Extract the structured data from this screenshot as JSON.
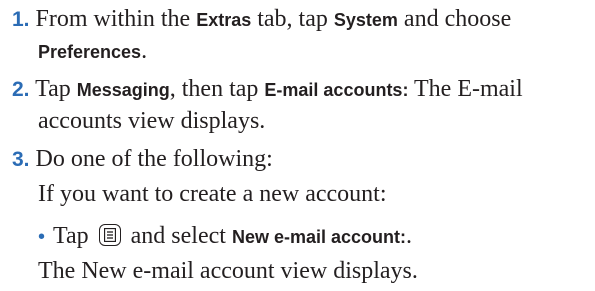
{
  "steps": [
    {
      "num": "1.",
      "t1": "From within the ",
      "u1": "Extras",
      "t2": " tab, tap ",
      "u2": "System",
      "t3": " and choose",
      "u3": "Preferences",
      "t4": "."
    },
    {
      "num": "2.",
      "t1": "Tap ",
      "u1": "Messaging",
      "t2": ", then tap ",
      "u2": "E-mail accounts:",
      "t3": " The E-mail",
      "t4": "accounts view displays."
    },
    {
      "num": "3.",
      "t1": "Do one of the following:"
    }
  ],
  "if_text": "If you want to create a new account:",
  "bullet": {
    "t1": "Tap ",
    "icon": "menu-icon",
    "t2": " and select ",
    "u1": "New e-mail account:",
    "t3": "."
  },
  "result_text": "The New e-mail account view displays."
}
